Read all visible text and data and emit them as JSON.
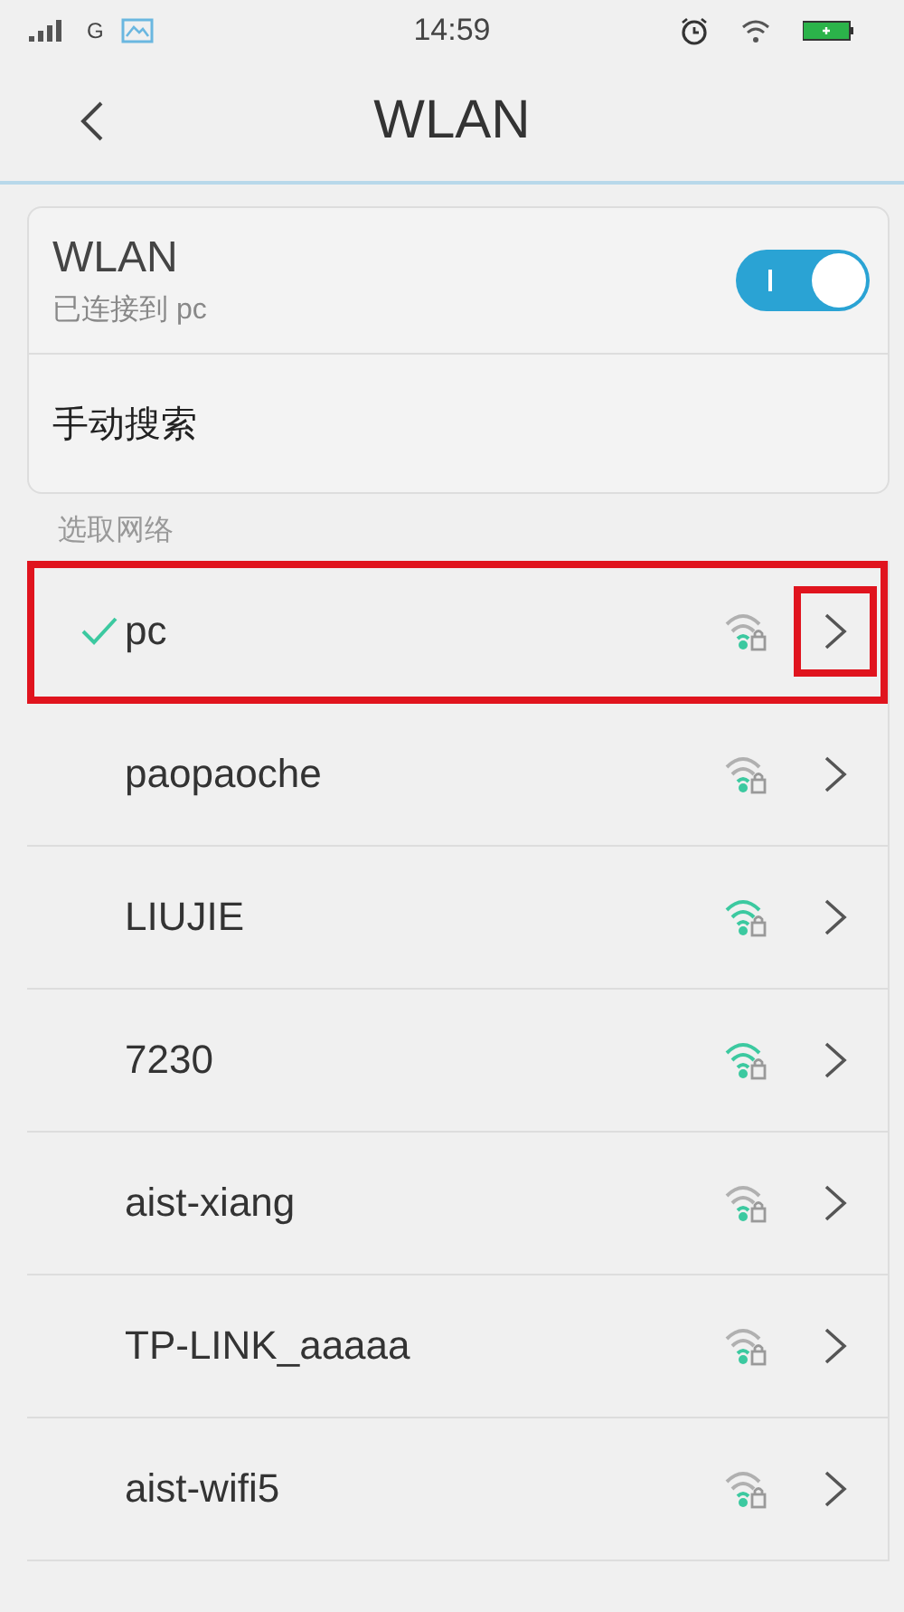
{
  "status_bar": {
    "carrier_type": "G",
    "time": "14:59"
  },
  "header": {
    "title": "WLAN"
  },
  "wlan": {
    "label": "WLAN",
    "status": "已连接到 pc",
    "on": true
  },
  "manual_search": {
    "label": "手动搜索"
  },
  "section_label": "选取网络",
  "networks": [
    {
      "name": "pc",
      "connected": true,
      "strong_signal": false,
      "highlighted": true,
      "chevron_highlighted": true
    },
    {
      "name": "paopaoche",
      "connected": false,
      "strong_signal": false,
      "highlighted": false,
      "chevron_highlighted": false
    },
    {
      "name": "LIUJIE",
      "connected": false,
      "strong_signal": true,
      "highlighted": false,
      "chevron_highlighted": false
    },
    {
      "name": "7230",
      "connected": false,
      "strong_signal": true,
      "highlighted": false,
      "chevron_highlighted": false
    },
    {
      "name": "aist-xiang",
      "connected": false,
      "strong_signal": false,
      "highlighted": false,
      "chevron_highlighted": false
    },
    {
      "name": "TP-LINK_aaaaa",
      "connected": false,
      "strong_signal": false,
      "highlighted": false,
      "chevron_highlighted": false
    },
    {
      "name": "aist-wifi5",
      "connected": false,
      "strong_signal": false,
      "highlighted": false,
      "chevron_highlighted": false
    }
  ]
}
